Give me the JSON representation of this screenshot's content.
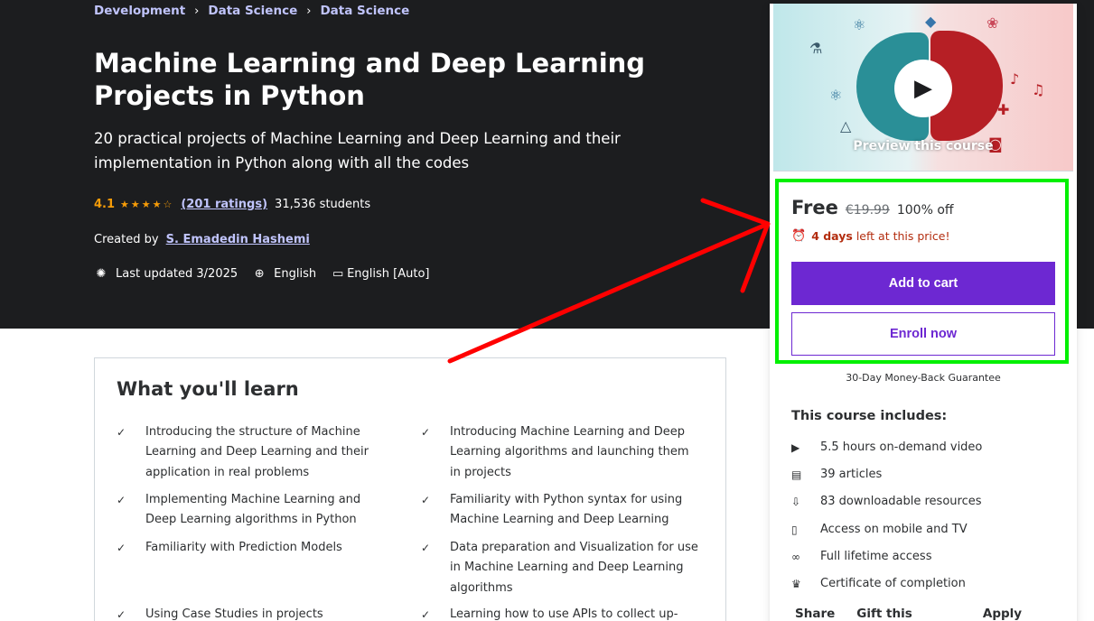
{
  "breadcrumb": {
    "items": [
      "Development",
      "Data Science",
      "Data Science"
    ],
    "separator": "›"
  },
  "course": {
    "title": "Machine Learning and Deep Learning Projects in Python",
    "subtitle": "20 practical projects of Machine Learning and Deep Learning and their implementation in Python along with all the codes",
    "rating": "4.1",
    "stars": "★★★★☆",
    "ratings_count": "(201 ratings)",
    "students": "31,536 students",
    "created_by_label": "Created by",
    "author": "S. Emadedin Hashemi",
    "last_updated": "Last updated 3/2025",
    "language": "English",
    "captions": "English [Auto]"
  },
  "learn": {
    "title": "What you'll learn",
    "items": [
      "Introducing the structure of Machine Learning and Deep Learning and their application in real problems",
      "Introducing Machine Learning and Deep Learning algorithms and launching them in projects",
      "Implementing Machine Learning and Deep Learning algorithms in Python",
      "Familiarity with Python syntax for using Machine Learning and Deep Learning",
      "Familiarity with Prediction Models",
      "Data preparation and Visualization for use in Machine Learning and Deep Learning algorithms",
      "Using Case Studies in projects",
      "Learning how to use APIs to collect up-to-"
    ]
  },
  "sidebar": {
    "preview_label": "Preview this course",
    "price": "Free",
    "original_price": "€19.99",
    "discount": "100% off",
    "timer_bold": "4 days",
    "timer_rest": "left at this price!",
    "add_to_cart": "Add to cart",
    "enroll_now": "Enroll now",
    "guarantee": "30-Day Money-Back Guarantee",
    "includes_title": "This course includes:",
    "includes": [
      "5.5 hours on-demand video",
      "39 articles",
      "83 downloadable resources",
      "Access on mobile and TV",
      "Full lifetime access",
      "Certificate of completion"
    ],
    "links": [
      "Share",
      "Gift this course",
      "Apply Coupon"
    ]
  },
  "colors": {
    "hero_bg": "#1c1d1f",
    "accent_purple": "#6d28d2",
    "link_lavender": "#c0c4fc",
    "star_orange": "#f69c08",
    "timer_red": "#b32d0f",
    "highlight_green": "#00f000",
    "arrow_red": "#ff0000"
  }
}
